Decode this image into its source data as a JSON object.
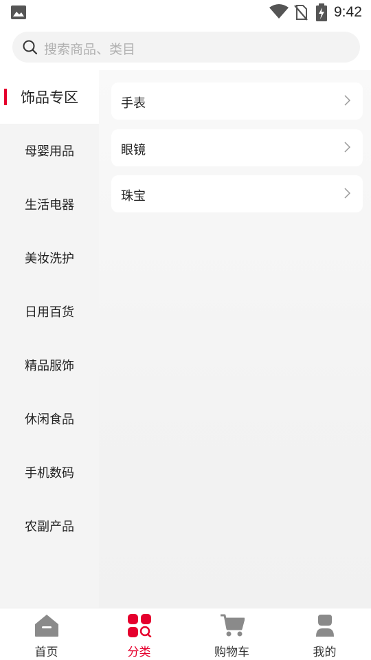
{
  "status_bar": {
    "time": "9:42"
  },
  "search": {
    "placeholder": "搜索商品、类目"
  },
  "sidebar": {
    "items": [
      {
        "label": "饰品专区",
        "active": true
      },
      {
        "label": "母婴用品"
      },
      {
        "label": "生活电器"
      },
      {
        "label": "美妆洗护"
      },
      {
        "label": "日用百货"
      },
      {
        "label": "精品服饰"
      },
      {
        "label": "休闲食品"
      },
      {
        "label": "手机数码"
      },
      {
        "label": "农副产品"
      }
    ]
  },
  "content": {
    "subcategories": [
      {
        "label": "手表"
      },
      {
        "label": "眼镜"
      },
      {
        "label": "珠宝"
      }
    ]
  },
  "tabbar": {
    "items": [
      {
        "label": "首页",
        "icon": "home-icon"
      },
      {
        "label": "分类",
        "icon": "category-icon",
        "active": true
      },
      {
        "label": "购物车",
        "icon": "cart-icon"
      },
      {
        "label": "我的",
        "icon": "profile-icon"
      }
    ]
  },
  "colors": {
    "accent": "#e5002d",
    "icon_gray": "#8a8a8a",
    "background": "#f4f4f4"
  }
}
